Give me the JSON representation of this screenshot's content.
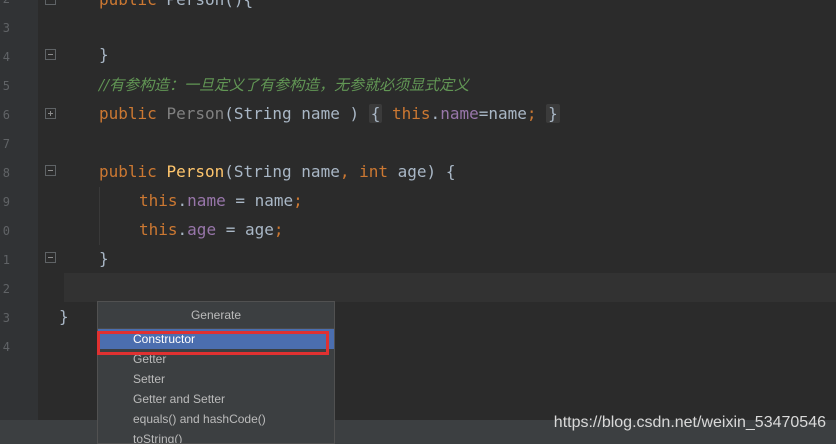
{
  "editor": {
    "line_numbers": [
      "2",
      "3",
      "4",
      "5",
      "6",
      "7",
      "8",
      "9",
      "0",
      "1",
      "2",
      "3",
      "4",
      "5"
    ],
    "lines": {
      "l0_kw": "public",
      "l0_rest": " Person(){",
      "l2": "}",
      "l3_comment": "//有参构造：一旦定义了有参构造，无参就必须显式定义",
      "l4_kw": "public",
      "l4_name": "Person",
      "l4_params": "(String name )",
      "l4_folded_open": "{",
      "l4_this": "this",
      "l4_dot": ".",
      "l4_field": "name",
      "l4_assign": "=name",
      "l4_semi": ";",
      "l4_folded_close": "}",
      "l6_kw": "public",
      "l6_name": "Person",
      "l6_p1": "(String name",
      "l6_comma": ",",
      "l6_int": "int",
      "l6_p2": " age) {",
      "l7_this": "this",
      "l7_dot": ".",
      "l7_field": "name",
      "l7_rest": " = name",
      "l7_semi": ";",
      "l8_this": "this",
      "l8_dot": ".",
      "l8_field": "age",
      "l8_rest": " = age",
      "l8_semi": ";",
      "l9": "}",
      "l11": "}"
    }
  },
  "generate_popup": {
    "title": "Generate",
    "items": [
      "Constructor",
      "Getter",
      "Setter",
      "Getter and Setter",
      "equals() and hashCode()",
      "toString()"
    ],
    "selected_index": 0
  },
  "watermark": "https://blog.csdn.net/weixin_53470546",
  "colors": {
    "background": "#2b2b2b",
    "keyword": "#cc7832",
    "method": "#ffc66d",
    "field": "#9876aa",
    "comment": "#629755",
    "selection": "#4b6eaf",
    "highlight_box": "#e03131"
  }
}
